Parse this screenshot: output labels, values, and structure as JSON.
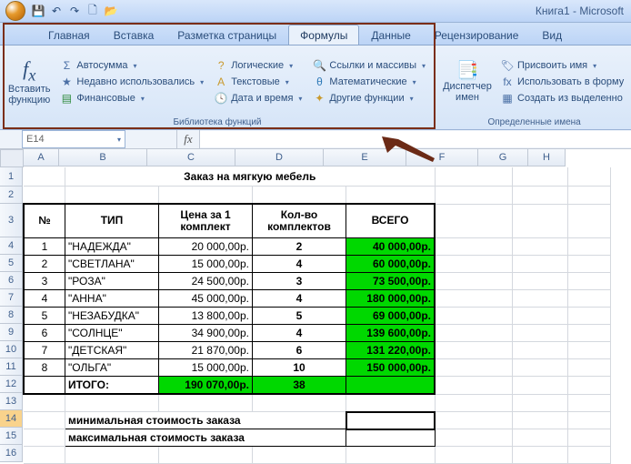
{
  "app": {
    "title": "Книга1 - Microsoft"
  },
  "qat": {
    "save": "💾",
    "undo": "↶",
    "redo": "↷",
    "new": "🗋",
    "open": "📂"
  },
  "tabs": {
    "home": "Главная",
    "insert": "Вставка",
    "layout": "Разметка страницы",
    "formulas": "Формулы",
    "data": "Данные",
    "review": "Рецензирование",
    "view": "Вид"
  },
  "ribbon": {
    "insert_fn": "Вставить функцию",
    "autosum": "Автосумма",
    "recent": "Недавно использовались",
    "financial": "Финансовые",
    "logical": "Логические",
    "text": "Текстовые",
    "datetime": "Дата и время",
    "lookup": "Ссылки и массивы",
    "math": "Математические",
    "more": "Другие функции",
    "lib_title": "Библиотека функций",
    "name_mgr": "Диспетчер имен",
    "define_name": "Присвоить имя",
    "use_in_formula": "Использовать в форму",
    "create_from_sel": "Создать из выделенно",
    "names_title": "Определенные имена"
  },
  "formula_bar": {
    "namebox": "E14",
    "fx": "fx"
  },
  "columns": {
    "A": 38,
    "B": 96,
    "C": 96,
    "D": 96,
    "E": 90,
    "F": 78,
    "G": 54,
    "H": 40
  },
  "sheet": {
    "title": "Заказ на мягкую мебель",
    "headers": {
      "num": "№",
      "type": "ТИП",
      "price": "Цена за 1 комплект",
      "qty": "Кол-во комплектов",
      "total": "ВСЕГО"
    },
    "rows": [
      {
        "n": "1",
        "type": "\"НАДЕЖДА\"",
        "price": "20 000,00р.",
        "qty": "2",
        "total": "40 000,00р."
      },
      {
        "n": "2",
        "type": "\"СВЕТЛАНА\"",
        "price": "15 000,00р.",
        "qty": "4",
        "total": "60 000,00р."
      },
      {
        "n": "3",
        "type": "\"РОЗА\"",
        "price": "24 500,00р.",
        "qty": "3",
        "total": "73 500,00р."
      },
      {
        "n": "4",
        "type": "\"АННА\"",
        "price": "45 000,00р.",
        "qty": "4",
        "total": "180 000,00р."
      },
      {
        "n": "5",
        "type": "\"НЕЗАБУДКА\"",
        "price": "13 800,00р.",
        "qty": "5",
        "total": "69 000,00р."
      },
      {
        "n": "6",
        "type": "\"СОЛНЦЕ\"",
        "price": "34 900,00р.",
        "qty": "4",
        "total": "139 600,00р."
      },
      {
        "n": "7",
        "type": "\"ДЕТСКАЯ\"",
        "price": "21 870,00р.",
        "qty": "6",
        "total": "131 220,00р."
      },
      {
        "n": "8",
        "type": "\"ОЛЬГА\"",
        "price": "15 000,00р.",
        "qty": "10",
        "total": "150 000,00р."
      }
    ],
    "total_row": {
      "label": "ИТОГО:",
      "price": "190 070,00р.",
      "qty": "38"
    },
    "min_label": "минимальная стоимость заказа",
    "max_label": "максимальная стоимость заказа"
  }
}
